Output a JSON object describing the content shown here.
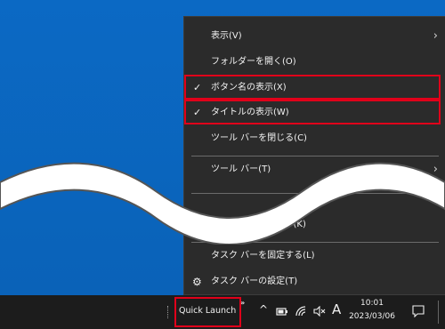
{
  "context_menu": {
    "items": [
      {
        "label": "表示(V)",
        "has_submenu": true
      },
      {
        "label": "フォルダーを開く(O)"
      },
      {
        "label": "ボタン名の表示(X)",
        "checked": true
      },
      {
        "label": "タイトルの表示(W)",
        "checked": true
      },
      {
        "label": "ツール バーを閉じる(C)"
      },
      {
        "label": "ツール バー(T)",
        "has_submenu": true
      },
      {
        "label": "タスク マネージャー(K)"
      },
      {
        "label": "タスク バーを固定する(L)"
      },
      {
        "label": "タスク バーの設定(T)",
        "icon": "gear-icon"
      }
    ],
    "checkmark": "✓",
    "submenu_arrow": "›",
    "gear_glyph": "⚙"
  },
  "taskbar": {
    "quick_launch_label": "Quick Launch",
    "chevron": "»",
    "tray": {
      "up_arrow": "^",
      "ime_indicator": "A",
      "time": "10:01",
      "date": "2023/03/06"
    }
  },
  "colors": {
    "desktop": "#0a67c0",
    "menu_bg": "#2b2b2b",
    "highlight_border": "#e0001a",
    "taskbar_bg": "#1c1c1c"
  }
}
